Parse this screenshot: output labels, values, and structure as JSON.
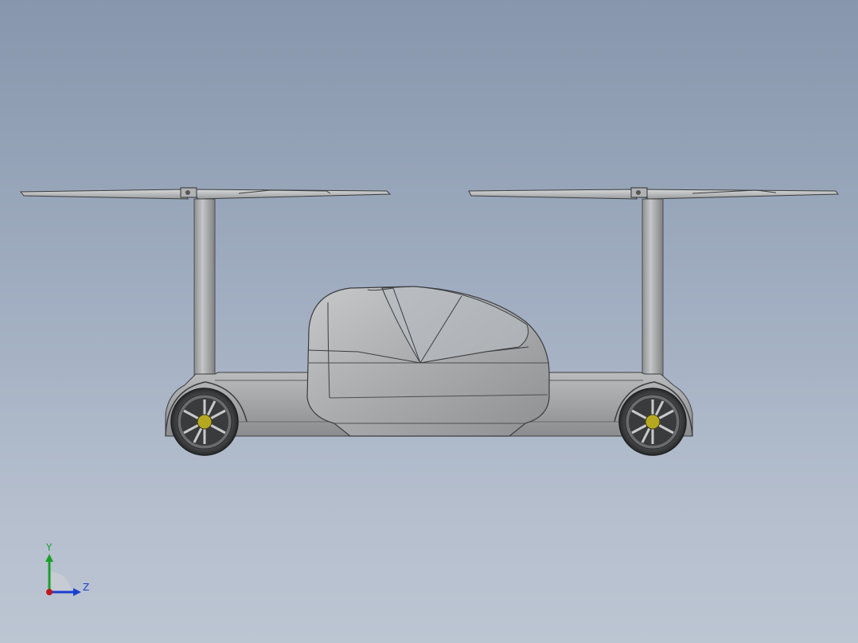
{
  "viewport": {
    "background_top": "#8796ad",
    "background_bottom": "#bcc5d2"
  },
  "model": {
    "description_icon": "flying-car-model",
    "body_color": "#9ea0a2",
    "hub_color": "#b5a820"
  },
  "triad": {
    "y_label": "Y",
    "z_label": "Z",
    "y_color": "#1aa02a",
    "z_color": "#1a3fd0",
    "x_color": "#c01818"
  }
}
